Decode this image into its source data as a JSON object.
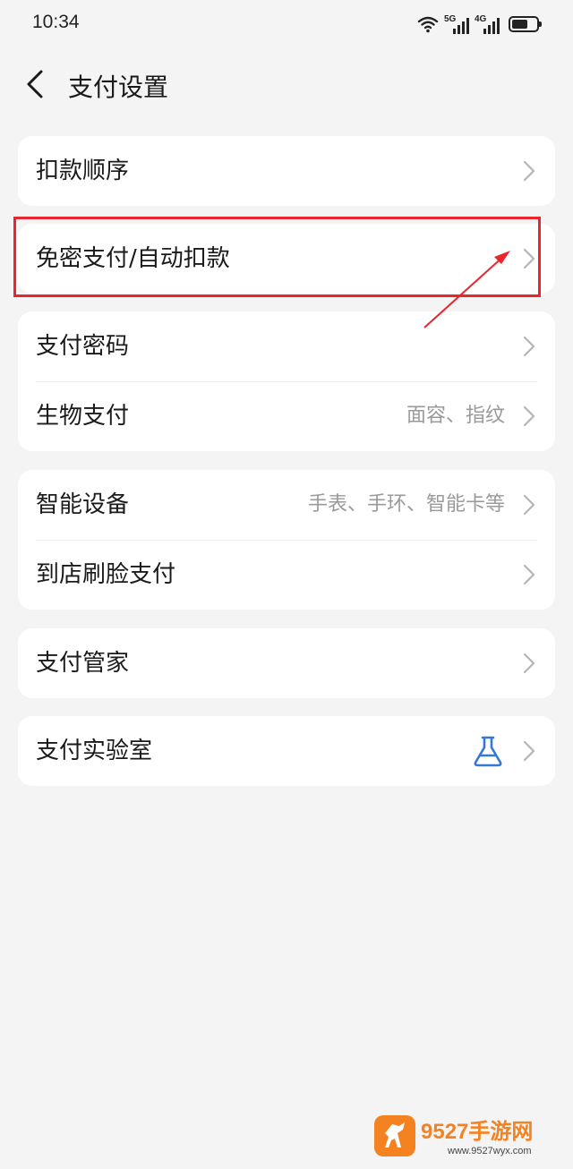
{
  "status_bar": {
    "time": "10:34",
    "network_1": "5G",
    "network_2": "4G",
    "battery_level": 0.65,
    "icons": [
      "wifi-icon",
      "signal-5g-icon",
      "signal-4g-icon",
      "battery-icon"
    ]
  },
  "header": {
    "title": "支付设置",
    "back_icon": "chevron-left-icon"
  },
  "groups": [
    {
      "items": [
        {
          "label": "扣款顺序",
          "value": ""
        }
      ]
    },
    {
      "items": [
        {
          "label": "免密支付/自动扣款",
          "value": ""
        }
      ]
    },
    {
      "items": [
        {
          "label": "支付密码",
          "value": ""
        },
        {
          "label": "生物支付",
          "value": "面容、指纹"
        }
      ]
    },
    {
      "items": [
        {
          "label": "智能设备",
          "value": "手表、手环、智能卡等"
        },
        {
          "label": "到店刷脸支付",
          "value": ""
        }
      ]
    },
    {
      "items": [
        {
          "label": "支付管家",
          "value": ""
        }
      ]
    },
    {
      "items": [
        {
          "label": "支付实验室",
          "value": "",
          "icon": "flask-icon"
        }
      ]
    }
  ],
  "annotation": {
    "highlight_color": "#e8262b"
  },
  "watermark": {
    "brand": "9527手游网",
    "url": "www.9527wyx.com"
  },
  "colors": {
    "background": "#f4f4f4",
    "card": "#ffffff",
    "accent_icon": "#3478d6"
  }
}
